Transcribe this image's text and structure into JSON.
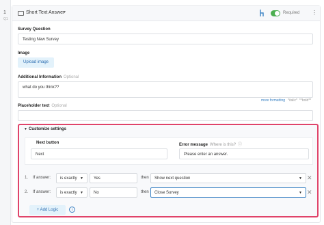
{
  "gutter": {
    "number": "1",
    "sub": "Q1"
  },
  "header": {
    "type_label": "Short Text Answer",
    "required_label": "Required",
    "required_on": true,
    "colors": {
      "toggle": "#4caf50",
      "icon": "#3b82c4"
    }
  },
  "fields": {
    "question_label": "Survey Question",
    "question_value": "Testing New Survey",
    "image_label": "Image",
    "upload_label": "Upload image",
    "additional_label": "Additional Information",
    "additional_optional": "Optional",
    "additional_value": "what do you think??",
    "placeholder_label": "Placeholder text",
    "placeholder_optional": "Optional",
    "placeholder_value": ""
  },
  "formatting": {
    "link": "more formatting",
    "italic": "*italic*",
    "bold": "**bold**"
  },
  "customize": {
    "title": "Customize settings",
    "border_color": "#e0446a",
    "next_button_label": "Next button",
    "next_button_value": "Next",
    "error_label": "Error message",
    "error_hint": "Where is this?",
    "error_value": "Please enter an answer.",
    "logic": [
      {
        "index": "1.",
        "if_label": "If answer:",
        "operator": "is exactly",
        "value": "Yes",
        "then_label": "then",
        "action": "Show next question"
      },
      {
        "index": "2.",
        "if_label": "If answer:",
        "operator": "is exactly",
        "value": "No",
        "then_label": "then",
        "action": "Close Survey"
      }
    ],
    "add_logic_label": "+ Add Logic"
  }
}
